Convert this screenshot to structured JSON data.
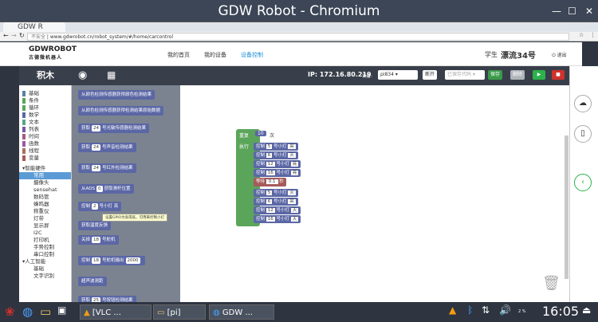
{
  "window": {
    "title": "GDW Robot - Chromium",
    "tab_title": "GDW R"
  },
  "address": {
    "secure_label": "不安全",
    "url": "www.gdwrobot.cn/robot_system/#/home/carcontrol"
  },
  "header": {
    "logo": "GDWROBOT",
    "logo_sub": "古德微机器人",
    "nav": [
      "我的首页",
      "我的设备",
      "设备控制"
    ],
    "user_label": "学生",
    "user_name": "漂流34号",
    "logout": "退出"
  },
  "toolbar": {
    "panel_title": "积木",
    "ip": "IP: 172.16.80.219",
    "device_label": "设备:",
    "device": "pi834",
    "disconnect": "断开",
    "code_placeholder": "已保存代码",
    "save": "保存",
    "delete": "删除"
  },
  "categories": [
    {
      "label": "基础",
      "color": "#5b80a5"
    },
    {
      "label": "条件",
      "color": "#5ba55b"
    },
    {
      "label": "循环",
      "color": "#5ba55b"
    },
    {
      "label": "数学",
      "color": "#5b67a5"
    },
    {
      "label": "文本",
      "color": "#5ba58c"
    },
    {
      "label": "列表",
      "color": "#745ba5"
    },
    {
      "label": "时间",
      "color": "#a55b80"
    },
    {
      "label": "函数",
      "color": "#995ba5"
    },
    {
      "label": "线程",
      "color": "#a5745b"
    },
    {
      "label": "变量",
      "color": "#a55b5b"
    }
  ],
  "hardware": {
    "group": "智能硬件",
    "items": [
      "常用",
      "摄像头",
      "sensehat",
      "数码管",
      "蜂鸣器",
      "称重仪",
      "灯带",
      "显示屏",
      "I2C",
      "打印机",
      "手势控制",
      "串口控制"
    ]
  },
  "ai": {
    "group": "人工智能",
    "items": [
      "基础",
      "文字识别"
    ]
  },
  "flyout": [
    {
      "text": "从颜色检测传感器获得颜色检测结果"
    },
    {
      "text": "从颜色检测传感器获得检测结果原始数据"
    },
    {
      "text": "获取",
      "num": "24",
      "text2": "号光敏传感器检测结果"
    },
    {
      "text": "获取",
      "num": "24",
      "text2": "号声音检测结果"
    },
    {
      "text": "获取",
      "num": "24",
      "text2": "号红外检测结果"
    },
    {
      "text": "从ADS",
      "num": "0",
      "text2": "获取滑杆位置"
    },
    {
      "text": "控制",
      "num": "2",
      "text2": "号小灯 亮"
    },
    {
      "text": "获取温度反馈"
    },
    {
      "text": "关掉",
      "num": "18",
      "text2": "号舵机"
    },
    {
      "text": "控制",
      "num": "18",
      "text2": "号舵机输出",
      "num2": "2000"
    },
    {
      "text": "超声波测距"
    },
    {
      "text": "获取",
      "num": "25",
      "text2": "号按钮检测结果"
    }
  ],
  "tooltip": "设置GPIO为高或低，可用来控制小灯",
  "program": {
    "repeat": "重复",
    "times": "10",
    "times_label": "次",
    "do": "执行",
    "lines": [
      {
        "action": "控制",
        "pin": "5",
        "label": "号小灯",
        "state": "亮"
      },
      {
        "action": "控制",
        "pin": "6",
        "label": "号小灯",
        "state": "灭"
      },
      {
        "action": "控制",
        "pin": "12",
        "label": "号小灯",
        "state": "亮"
      },
      {
        "action": "控制",
        "pin": "16",
        "label": "号小灯",
        "state": "亮"
      }
    ],
    "wait_label": "等待",
    "wait_value": "0.1",
    "wait_unit": "秒",
    "lines2": [
      {
        "action": "控制",
        "pin": "5",
        "label": "号小灯",
        "state": "灭"
      },
      {
        "action": "控制",
        "pin": "6",
        "label": "号小灯",
        "state": "亮"
      },
      {
        "action": "控制",
        "pin": "12",
        "label": "号小灯",
        "state": "灭"
      },
      {
        "action": "控制",
        "pin": "16",
        "label": "号小灯",
        "state": "灭"
      }
    ]
  },
  "taskbar": {
    "tasks": [
      "[VLC ...",
      "[pi]",
      "GDW ..."
    ],
    "clock": "16:05",
    "badge": "2 %"
  }
}
